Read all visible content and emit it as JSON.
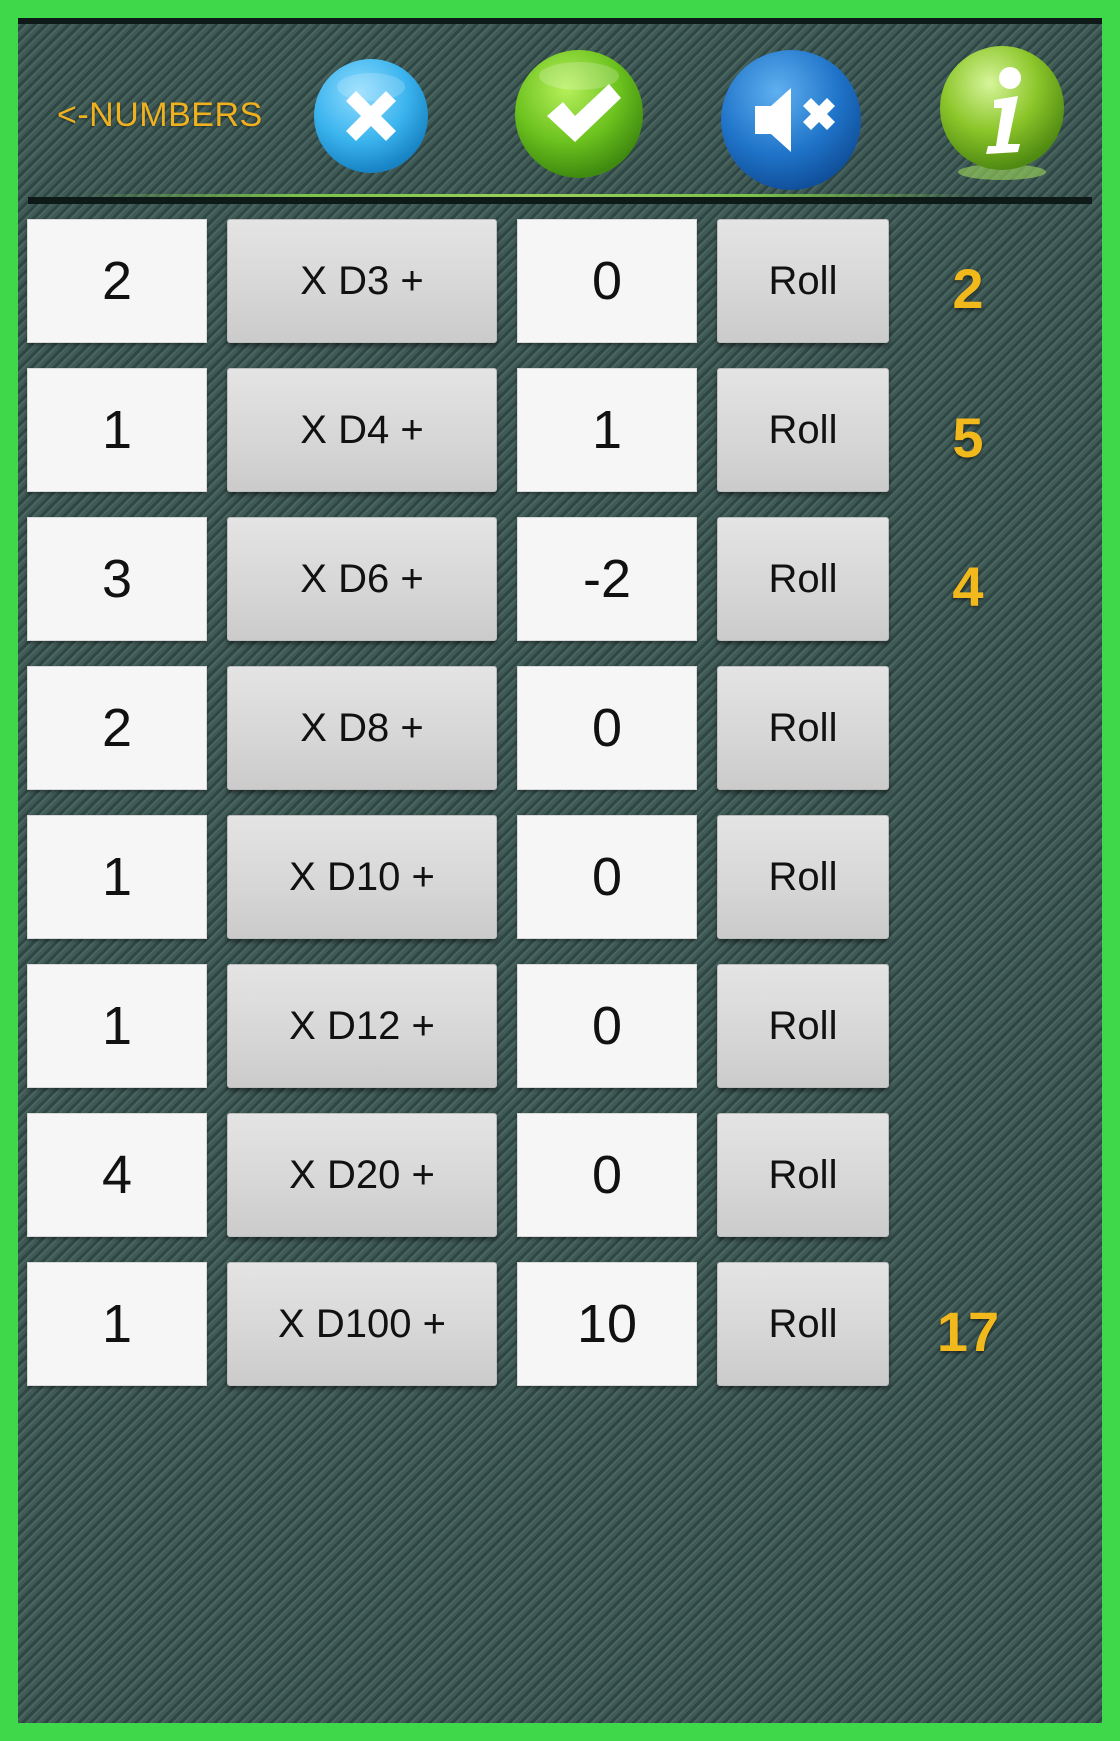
{
  "header": {
    "numbers_link": "<-NUMBERS",
    "icons": {
      "cancel": "close-x-icon",
      "confirm": "checkmark-icon",
      "mute": "speaker-mute-icon",
      "info": "info-icon"
    }
  },
  "rows": [
    {
      "count": "2",
      "die": "X D3 +",
      "modifier": "0",
      "roll": "Roll",
      "result": "2"
    },
    {
      "count": "1",
      "die": "X D4 +",
      "modifier": "1",
      "roll": "Roll",
      "result": "5"
    },
    {
      "count": "3",
      "die": "X D6 +",
      "modifier": "-2",
      "roll": "Roll",
      "result": "4"
    },
    {
      "count": "2",
      "die": "X D8 +",
      "modifier": "0",
      "roll": "Roll",
      "result": ""
    },
    {
      "count": "1",
      "die": "X D10 +",
      "modifier": "0",
      "roll": "Roll",
      "result": ""
    },
    {
      "count": "1",
      "die": "X D12 +",
      "modifier": "0",
      "roll": "Roll",
      "result": ""
    },
    {
      "count": "4",
      "die": "X D20 +",
      "modifier": "0",
      "roll": "Roll",
      "result": ""
    },
    {
      "count": "1",
      "die": "X D100 +",
      "modifier": "10",
      "roll": "Roll",
      "result": "17"
    }
  ],
  "colors": {
    "border": "#3fd84a",
    "background": "#3b5552",
    "accent_text": "#f2b91c",
    "cancel_blue": "#3bb4ee",
    "confirm_green": "#6cc21e",
    "mute_blue": "#1f73c8",
    "info_green": "#8cc62a"
  }
}
